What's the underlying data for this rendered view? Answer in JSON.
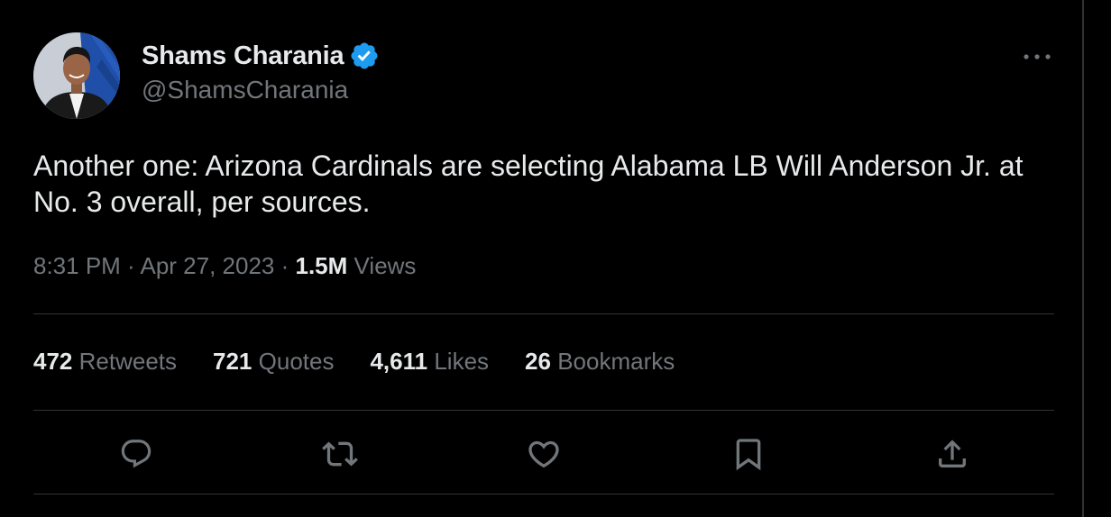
{
  "author": {
    "display_name": "Shams Charania",
    "handle": "@ShamsCharania",
    "verified": true
  },
  "tweet": {
    "text": "Another one: Arizona Cardinals are selecting Alabama LB Will Anderson Jr. at No. 3 overall, per sources.",
    "time": "8:31 PM",
    "separator": " · ",
    "date": "Apr 27, 2023",
    "views_count": "1.5M",
    "views_label": "Views"
  },
  "stats": {
    "retweets": {
      "count": "472",
      "label": "Retweets"
    },
    "quotes": {
      "count": "721",
      "label": "Quotes"
    },
    "likes": {
      "count": "4,611",
      "label": "Likes"
    },
    "bookmarks": {
      "count": "26",
      "label": "Bookmarks"
    }
  },
  "actions": [
    "reply-icon",
    "retweet-icon",
    "like-icon",
    "bookmark-icon",
    "share-icon"
  ],
  "colors": {
    "background": "#000000",
    "primary_text": "#e7e9ea",
    "secondary_text": "#71767b",
    "divider": "#2f3336",
    "verified_blue": "#1d9bf0"
  }
}
